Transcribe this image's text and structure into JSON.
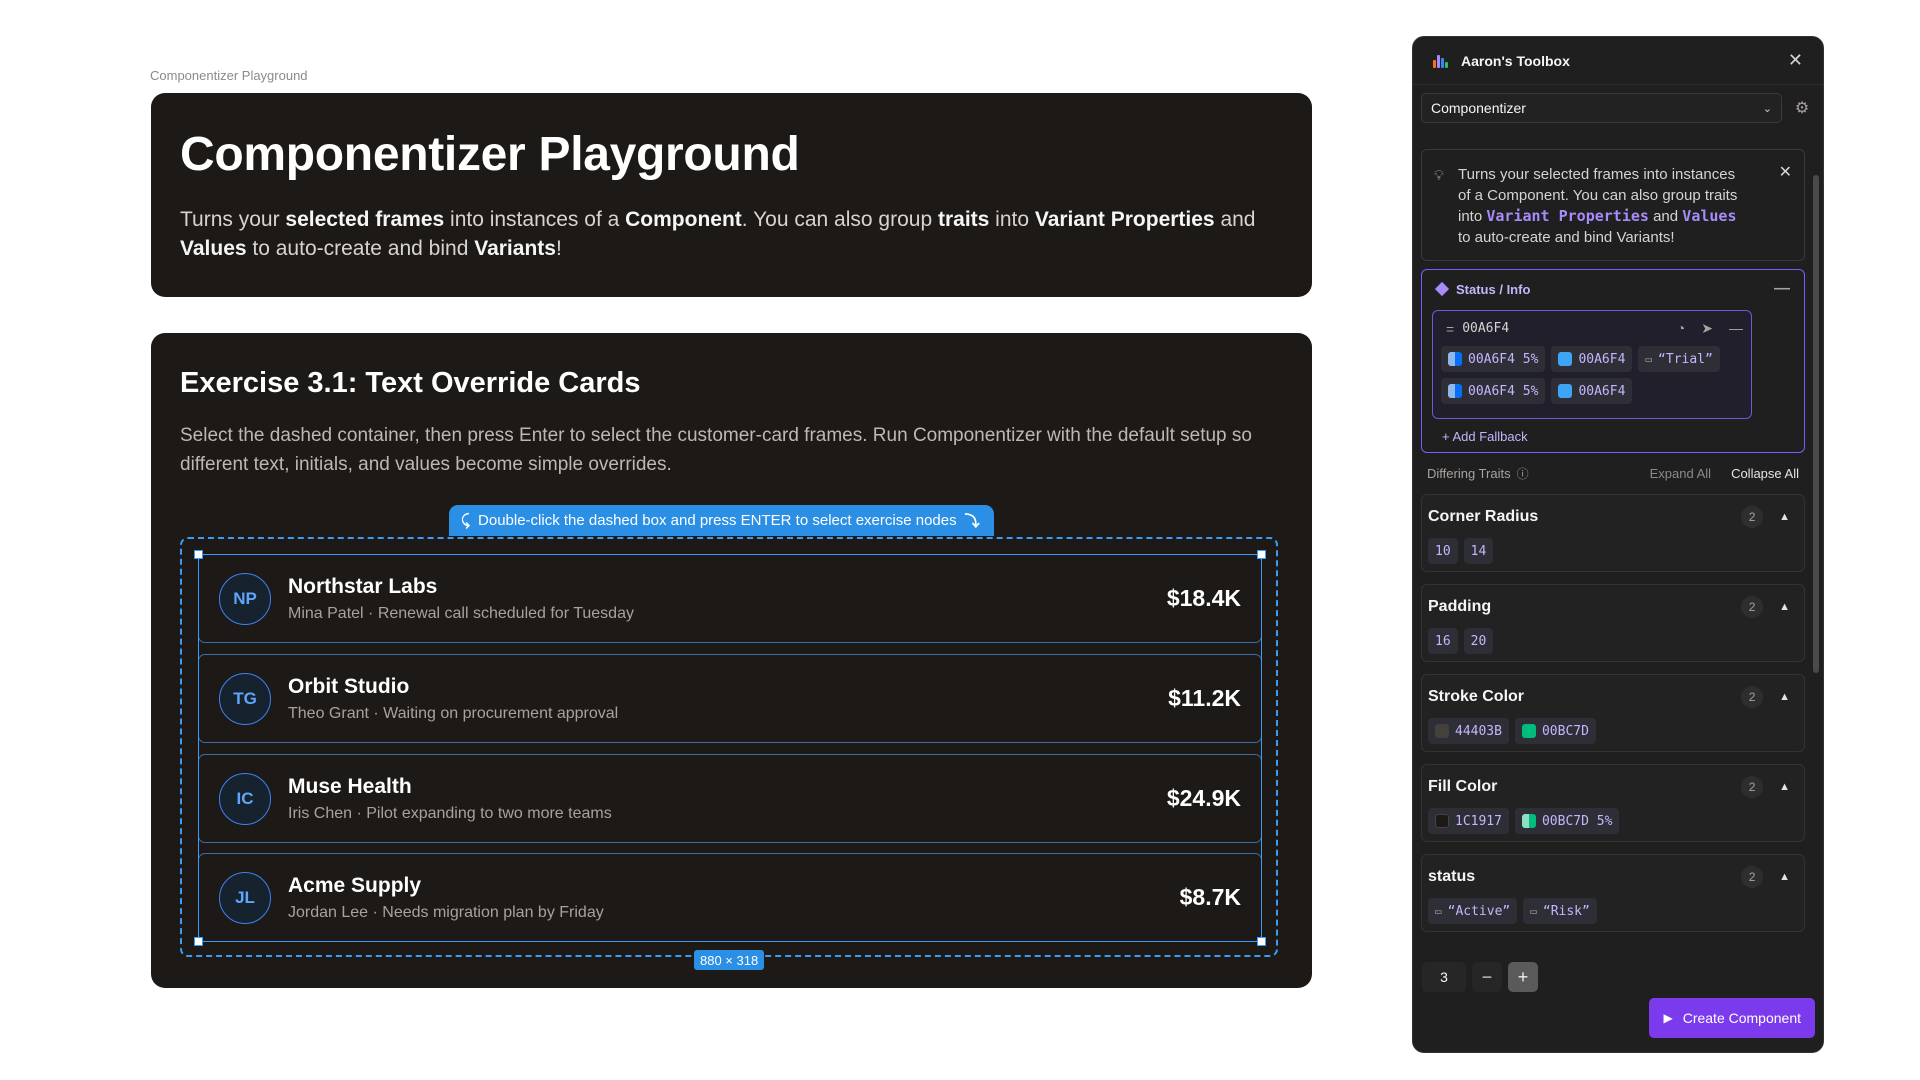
{
  "canvas": {
    "frame_label": "Componentizer Playground"
  },
  "hero": {
    "title": "Componentizer Playground",
    "desc_1": "Turns your ",
    "desc_2": "selected frames",
    "desc_3": " into instances of a ",
    "desc_4": "Component",
    "desc_5": ". You can also group ",
    "desc_6": "traits",
    "desc_7": " into ",
    "desc_8": "Variant Properties",
    "desc_9": " and ",
    "desc_10": "Values",
    "desc_11": " to auto-create and bind ",
    "desc_12": "Variants",
    "desc_13": "!"
  },
  "exercise": {
    "title": "Exercise 3.1: Text Override Cards",
    "description": "Select the dashed container, then press Enter to select the customer-card frames. Run Componentizer with the default setup so different text, initials, and values become simple overrides.",
    "hint": "Double-click the dashed box and press ENTER to select exercise nodes",
    "size_badge": "880 × 318",
    "cards": [
      {
        "initials": "NP",
        "name": "Northstar Labs",
        "subtitle": "Mina Patel · Renewal call scheduled for Tuesday",
        "value": "$18.4K"
      },
      {
        "initials": "TG",
        "name": "Orbit Studio",
        "subtitle": "Theo Grant · Waiting on procurement approval",
        "value": "$11.2K"
      },
      {
        "initials": "IC",
        "name": "Muse Health",
        "subtitle": "Iris Chen · Pilot expanding to two more teams",
        "value": "$24.9K"
      },
      {
        "initials": "JL",
        "name": "Acme Supply",
        "subtitle": "Jordan Lee · Needs migration plan by Friday",
        "value": "$8.7K"
      }
    ]
  },
  "panel": {
    "title": "Aaron's Toolbox",
    "tool_selected": "Componentizer",
    "info": {
      "t1": "Turns your selected frames into instances of a Component. You can also group traits into ",
      "kw1": "Variant Properties",
      "t2": " and ",
      "kw2": "Values",
      "t3": " to auto-create and bind Variants!"
    },
    "status": {
      "label": "Status / Info",
      "variant_name": "00A6F4",
      "chips_row1": [
        "00A6F4 5%",
        "00A6F4",
        "“Trial”"
      ],
      "chips_row2": [
        "00A6F4 5%",
        "00A6F4"
      ],
      "add_fallback": "+ Add Fallback"
    },
    "traits_header": {
      "label": "Differing Traits",
      "expand": "Expand All",
      "collapse": "Collapse All"
    },
    "traits": [
      {
        "name": "Corner Radius",
        "count": "2",
        "values": [
          "10",
          "14"
        ]
      },
      {
        "name": "Padding",
        "count": "2",
        "values": [
          "16",
          "20"
        ]
      },
      {
        "name": "Stroke Color",
        "count": "2",
        "values": [
          "44403B",
          "00BC7D"
        ]
      },
      {
        "name": "Fill Color",
        "count": "2",
        "values": [
          "1C1917",
          "00BC7D 5%"
        ]
      },
      {
        "name": "status",
        "count": "2",
        "values": [
          "“Active”",
          "“Risk”"
        ]
      }
    ],
    "stepper_value": "3",
    "create_label": "Create Component"
  },
  "colors": {
    "frame_bg": "#1c1917",
    "selection_blue": "#3b9cf5",
    "accent_purple": "#7c3aed",
    "chip_blue": "#0a6ff4",
    "stroke_dark": "#44403b",
    "green": "#00bc7d"
  },
  "icons": [
    "close-icon",
    "chevron-down-icon",
    "gear-icon",
    "lightbulb-icon",
    "diamond-icon",
    "minus-icon",
    "palette-icon",
    "cursor-icon",
    "text-icon",
    "info-icon",
    "caret-up-icon",
    "plus-icon",
    "play-icon"
  ]
}
